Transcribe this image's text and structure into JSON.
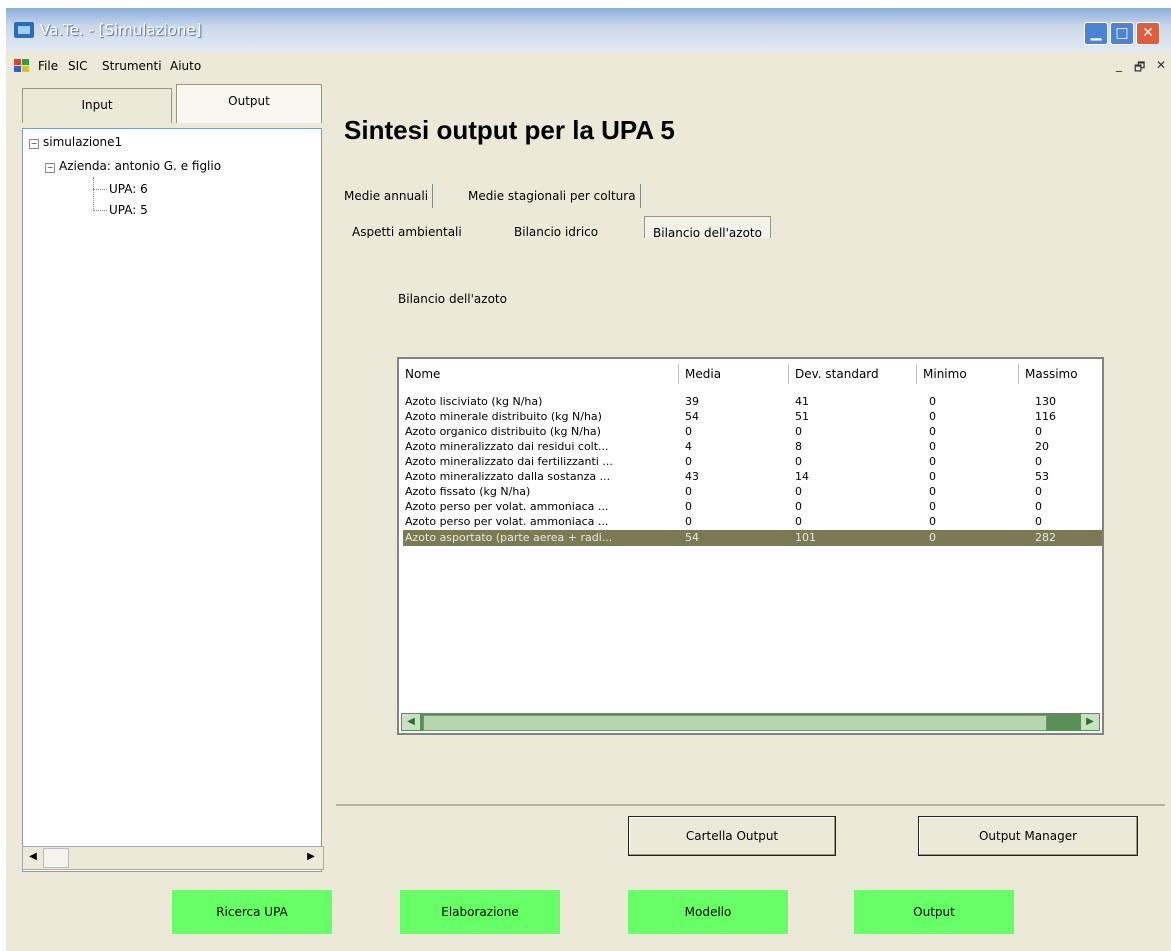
{
  "window": {
    "title": "Va.Te. - [Simulazione]",
    "controls": {
      "minimize": "▁",
      "maximize": "□",
      "close": "✕"
    }
  },
  "menubar": {
    "items": [
      "File",
      "SIC",
      "Strumenti",
      "Aiuto"
    ],
    "mdi_controls": [
      "_",
      "🗗",
      "✕"
    ]
  },
  "left_panel": {
    "tabs": [
      {
        "label": "Input",
        "selected": false
      },
      {
        "label": "Output",
        "selected": true
      }
    ],
    "tree": {
      "root": "simulazione1",
      "farm": "Azienda: antonio G. e figlio",
      "upas": [
        "UPA: 6",
        "UPA: 5"
      ],
      "selected": "UPA: 5"
    }
  },
  "main": {
    "heading": "Sintesi output per la UPA 5",
    "tabs_level1": [
      {
        "label": "Medie annuali",
        "selected": true
      },
      {
        "label": "Medie stagionali per coltura",
        "selected": false
      }
    ],
    "tabs_level2": [
      {
        "label": "Aspetti ambientali",
        "selected": false
      },
      {
        "label": "Bilancio idrico",
        "selected": false
      },
      {
        "label": "Bilancio dell'azoto",
        "selected": true
      }
    ],
    "section_caption": "Bilancio dell'azoto",
    "table": {
      "columns": [
        "Nome",
        "Media",
        "Dev. standard",
        "Minimo",
        "Massimo"
      ],
      "rows": [
        [
          "Azoto lisciviato (kg N/ha)",
          "39",
          "41",
          "0",
          "130"
        ],
        [
          "Azoto minerale distribuito (kg N/ha)",
          "54",
          "51",
          "0",
          "116"
        ],
        [
          "Azoto organico distribuito (kg N/ha)",
          "0",
          "0",
          "0",
          "0"
        ],
        [
          "Azoto mineralizzato dai residui colt...",
          "4",
          "8",
          "0",
          "20"
        ],
        [
          "Azoto mineralizzato dai fertilizzanti ...",
          "0",
          "0",
          "0",
          "0"
        ],
        [
          "Azoto mineralizzato dalla sostanza ...",
          "43",
          "14",
          "0",
          "53"
        ],
        [
          "Azoto fissato (kg N/ha)",
          "0",
          "0",
          "0",
          "0"
        ],
        [
          "Azoto perso per volat. ammoniaca ...",
          "0",
          "0",
          "0",
          "0"
        ],
        [
          "Azoto perso per volat. ammoniaca ...",
          "0",
          "0",
          "0",
          "0"
        ],
        [
          "Azoto asportato (parte aerea + radi...",
          "54",
          "101",
          "0",
          "282"
        ]
      ],
      "selected_row_index": 9
    },
    "buttons": {
      "cartella_output": "Cartella Output",
      "output_manager": "Output Manager"
    }
  },
  "bottom_buttons": [
    "Ricerca UPA",
    "Elaborazione",
    "Modello",
    "Output"
  ],
  "colors": {
    "window_bg": "#ece9d8",
    "green_button": "#66ff66",
    "selected_row": "#7b7a52",
    "title_gradient_top": "#8aaed9"
  }
}
